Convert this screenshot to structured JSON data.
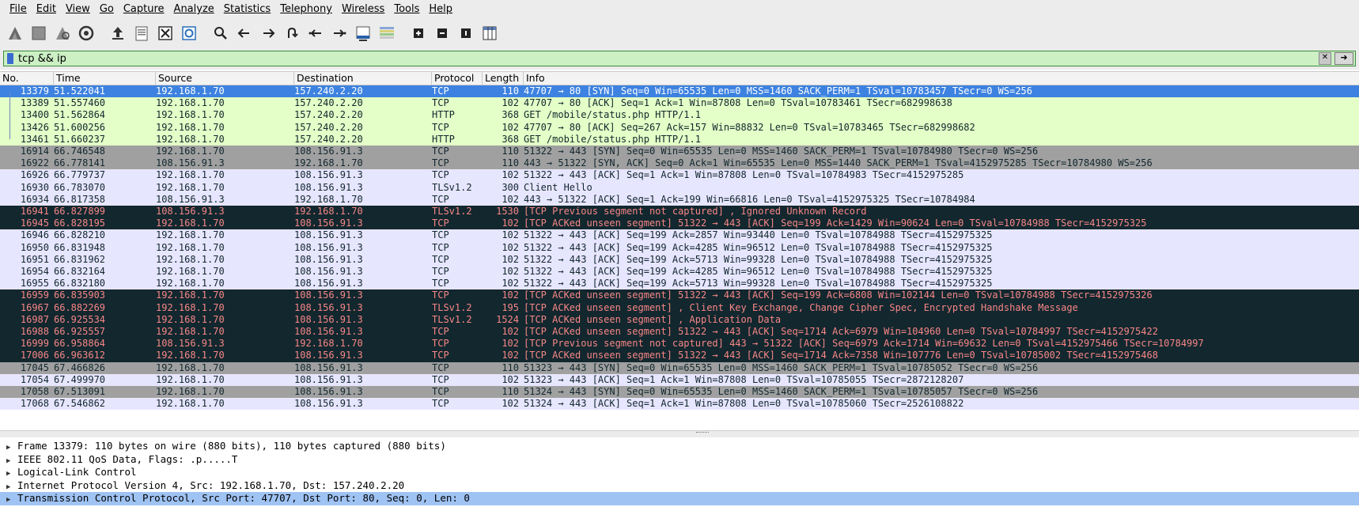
{
  "menu": [
    "File",
    "Edit",
    "View",
    "Go",
    "Capture",
    "Analyze",
    "Statistics",
    "Telephony",
    "Wireless",
    "Tools",
    "Help"
  ],
  "toolbar_icons": [
    "shark-fin-start-icon",
    "stop-square-icon",
    "shark-fin-restart-icon",
    "options-gear-icon",
    "open-file-icon",
    "file-icon",
    "close-file-icon",
    "reload-icon",
    "search-icon",
    "arrow-left-icon",
    "arrow-right-icon",
    "jump-to-icon",
    "first-packet-icon",
    "last-packet-icon",
    "autoscroll-icon",
    "colorize-icon",
    "zoom-in-icon",
    "zoom-out-icon",
    "normal-size-icon",
    "resize-columns-icon"
  ],
  "filter": {
    "value": "tcp && ip"
  },
  "columns": [
    "No.",
    "Time",
    "Source",
    "Destination",
    "Protocol",
    "Length",
    "Info"
  ],
  "colors": {
    "selected_bg": "#3d82e0",
    "green_bg": "#e4ffc7",
    "gray_bg": "#a0a0a0",
    "lavender_bg": "#e7e6ff",
    "dark_bg": "#12272e",
    "dark_fg": "#f78787"
  },
  "packets": [
    {
      "no": "13379",
      "time": "51.522041",
      "src": "192.168.1.70",
      "dst": "157.240.2.20",
      "proto": "TCP",
      "len": "110",
      "info": "47707 → 80 [SYN] Seq=0 Win=65535 Len=0 MSS=1460 SACK_PERM=1 TSval=10783457 TSecr=0 WS=256",
      "style": "selected"
    },
    {
      "no": "13389",
      "time": "51.557460",
      "src": "192.168.1.70",
      "dst": "157.240.2.20",
      "proto": "TCP",
      "len": "102",
      "info": "47707 → 80 [ACK] Seq=1 Ack=1 Win=87808 Len=0 TSval=10783461 TSecr=682998638",
      "style": "green"
    },
    {
      "no": "13400",
      "time": "51.562864",
      "src": "192.168.1.70",
      "dst": "157.240.2.20",
      "proto": "HTTP",
      "len": "368",
      "info": "GET /mobile/status.php HTTP/1.1",
      "style": "green"
    },
    {
      "no": "13426",
      "time": "51.600256",
      "src": "192.168.1.70",
      "dst": "157.240.2.20",
      "proto": "TCP",
      "len": "102",
      "info": "47707 → 80 [ACK] Seq=267 Ack=157 Win=88832 Len=0 TSval=10783465 TSecr=682998682",
      "style": "green"
    },
    {
      "no": "13461",
      "time": "51.660237",
      "src": "192.168.1.70",
      "dst": "157.240.2.20",
      "proto": "HTTP",
      "len": "368",
      "info": "GET /mobile/status.php HTTP/1.1",
      "style": "green"
    },
    {
      "no": "16914",
      "time": "66.746548",
      "src": "192.168.1.70",
      "dst": "108.156.91.3",
      "proto": "TCP",
      "len": "110",
      "info": "51322 → 443 [SYN] Seq=0 Win=65535 Len=0 MSS=1460 SACK_PERM=1 TSval=10784980 TSecr=0 WS=256",
      "style": "gray"
    },
    {
      "no": "16922",
      "time": "66.778141",
      "src": "108.156.91.3",
      "dst": "192.168.1.70",
      "proto": "TCP",
      "len": "110",
      "info": "443 → 51322 [SYN, ACK] Seq=0 Ack=1 Win=65535 Len=0 MSS=1440 SACK_PERM=1 TSval=4152975285 TSecr=10784980 WS=256",
      "style": "gray"
    },
    {
      "no": "16926",
      "time": "66.779737",
      "src": "192.168.1.70",
      "dst": "108.156.91.3",
      "proto": "TCP",
      "len": "102",
      "info": "51322 → 443 [ACK] Seq=1 Ack=1 Win=87808 Len=0 TSval=10784983 TSecr=4152975285",
      "style": "lavender"
    },
    {
      "no": "16930",
      "time": "66.783070",
      "src": "192.168.1.70",
      "dst": "108.156.91.3",
      "proto": "TLSv1.2",
      "len": "300",
      "info": "Client Hello",
      "style": "lavender"
    },
    {
      "no": "16934",
      "time": "66.817358",
      "src": "108.156.91.3",
      "dst": "192.168.1.70",
      "proto": "TCP",
      "len": "102",
      "info": "443 → 51322 [ACK] Seq=1 Ack=199 Win=66816 Len=0 TSval=4152975325 TSecr=10784984",
      "style": "lavender"
    },
    {
      "no": "16941",
      "time": "66.827899",
      "src": "108.156.91.3",
      "dst": "192.168.1.70",
      "proto": "TLSv1.2",
      "len": "1530",
      "info": "[TCP Previous segment not captured] , Ignored Unknown Record",
      "style": "dark"
    },
    {
      "no": "16945",
      "time": "66.828195",
      "src": "192.168.1.70",
      "dst": "108.156.91.3",
      "proto": "TCP",
      "len": "102",
      "info": "[TCP ACKed unseen segment] 51322 → 443 [ACK] Seq=199 Ack=1429 Win=90624 Len=0 TSval=10784988 TSecr=4152975325",
      "style": "dark"
    },
    {
      "no": "16946",
      "time": "66.828210",
      "src": "192.168.1.70",
      "dst": "108.156.91.3",
      "proto": "TCP",
      "len": "102",
      "info": "51322 → 443 [ACK] Seq=199 Ack=2857 Win=93440 Len=0 TSval=10784988 TSecr=4152975325",
      "style": "lavender"
    },
    {
      "no": "16950",
      "time": "66.831948",
      "src": "192.168.1.70",
      "dst": "108.156.91.3",
      "proto": "TCP",
      "len": "102",
      "info": "51322 → 443 [ACK] Seq=199 Ack=4285 Win=96512 Len=0 TSval=10784988 TSecr=4152975325",
      "style": "lavender"
    },
    {
      "no": "16951",
      "time": "66.831962",
      "src": "192.168.1.70",
      "dst": "108.156.91.3",
      "proto": "TCP",
      "len": "102",
      "info": "51322 → 443 [ACK] Seq=199 Ack=5713 Win=99328 Len=0 TSval=10784988 TSecr=4152975325",
      "style": "lavender"
    },
    {
      "no": "16954",
      "time": "66.832164",
      "src": "192.168.1.70",
      "dst": "108.156.91.3",
      "proto": "TCP",
      "len": "102",
      "info": "51322 → 443 [ACK] Seq=199 Ack=4285 Win=96512 Len=0 TSval=10784988 TSecr=4152975325",
      "style": "lavender"
    },
    {
      "no": "16955",
      "time": "66.832180",
      "src": "192.168.1.70",
      "dst": "108.156.91.3",
      "proto": "TCP",
      "len": "102",
      "info": "51322 → 443 [ACK] Seq=199 Ack=5713 Win=99328 Len=0 TSval=10784988 TSecr=4152975325",
      "style": "lavender"
    },
    {
      "no": "16959",
      "time": "66.835903",
      "src": "192.168.1.70",
      "dst": "108.156.91.3",
      "proto": "TCP",
      "len": "102",
      "info": "[TCP ACKed unseen segment] 51322 → 443 [ACK] Seq=199 Ack=6808 Win=102144 Len=0 TSval=10784988 TSecr=4152975326",
      "style": "dark"
    },
    {
      "no": "16967",
      "time": "66.882269",
      "src": "192.168.1.70",
      "dst": "108.156.91.3",
      "proto": "TLSv1.2",
      "len": "195",
      "info": "[TCP ACKed unseen segment] , Client Key Exchange, Change Cipher Spec, Encrypted Handshake Message",
      "style": "dark"
    },
    {
      "no": "16987",
      "time": "66.925534",
      "src": "192.168.1.70",
      "dst": "108.156.91.3",
      "proto": "TLSv1.2",
      "len": "1524",
      "info": "[TCP ACKed unseen segment] , Application Data",
      "style": "dark"
    },
    {
      "no": "16988",
      "time": "66.925557",
      "src": "192.168.1.70",
      "dst": "108.156.91.3",
      "proto": "TCP",
      "len": "102",
      "info": "[TCP ACKed unseen segment] 51322 → 443 [ACK] Seq=1714 Ack=6979 Win=104960 Len=0 TSval=10784997 TSecr=4152975422",
      "style": "dark"
    },
    {
      "no": "16999",
      "time": "66.958864",
      "src": "108.156.91.3",
      "dst": "192.168.1.70",
      "proto": "TCP",
      "len": "102",
      "info": "[TCP Previous segment not captured] 443 → 51322 [ACK] Seq=6979 Ack=1714 Win=69632 Len=0 TSval=4152975466 TSecr=10784997",
      "style": "dark"
    },
    {
      "no": "17006",
      "time": "66.963612",
      "src": "192.168.1.70",
      "dst": "108.156.91.3",
      "proto": "TCP",
      "len": "102",
      "info": "[TCP ACKed unseen segment] 51322 → 443 [ACK] Seq=1714 Ack=7358 Win=107776 Len=0 TSval=10785002 TSecr=4152975468",
      "style": "dark"
    },
    {
      "no": "17045",
      "time": "67.466826",
      "src": "192.168.1.70",
      "dst": "108.156.91.3",
      "proto": "TCP",
      "len": "110",
      "info": "51323 → 443 [SYN] Seq=0 Win=65535 Len=0 MSS=1460 SACK_PERM=1 TSval=10785052 TSecr=0 WS=256",
      "style": "gray"
    },
    {
      "no": "17054",
      "time": "67.499970",
      "src": "192.168.1.70",
      "dst": "108.156.91.3",
      "proto": "TCP",
      "len": "102",
      "info": "51323 → 443 [ACK] Seq=1 Ack=1 Win=87808 Len=0 TSval=10785055 TSecr=2872128207",
      "style": "lavender"
    },
    {
      "no": "17058",
      "time": "67.513091",
      "src": "192.168.1.70",
      "dst": "108.156.91.3",
      "proto": "TCP",
      "len": "110",
      "info": "51324 → 443 [SYN] Seq=0 Win=65535 Len=0 MSS=1460 SACK_PERM=1 TSval=10785057 TSecr=0 WS=256",
      "style": "gray"
    },
    {
      "no": "17068",
      "time": "67.546862",
      "src": "192.168.1.70",
      "dst": "108.156.91.3",
      "proto": "TCP",
      "len": "102",
      "info": "51324 → 443 [ACK] Seq=1 Ack=1 Win=87808 Len=0 TSval=10785060 TSecr=2526108822",
      "style": "lavender"
    }
  ],
  "details": [
    {
      "text": "Frame 13379: 110 bytes on wire (880 bits), 110 bytes captured (880 bits)",
      "selected": false
    },
    {
      "text": "IEEE 802.11 QoS Data, Flags: .p.....T",
      "selected": false
    },
    {
      "text": "Logical-Link Control",
      "selected": false
    },
    {
      "text": "Internet Protocol Version 4, Src: 192.168.1.70, Dst: 157.240.2.20",
      "selected": false
    },
    {
      "text": "Transmission Control Protocol, Src Port: 47707, Dst Port: 80, Seq: 0, Len: 0",
      "selected": true
    }
  ]
}
